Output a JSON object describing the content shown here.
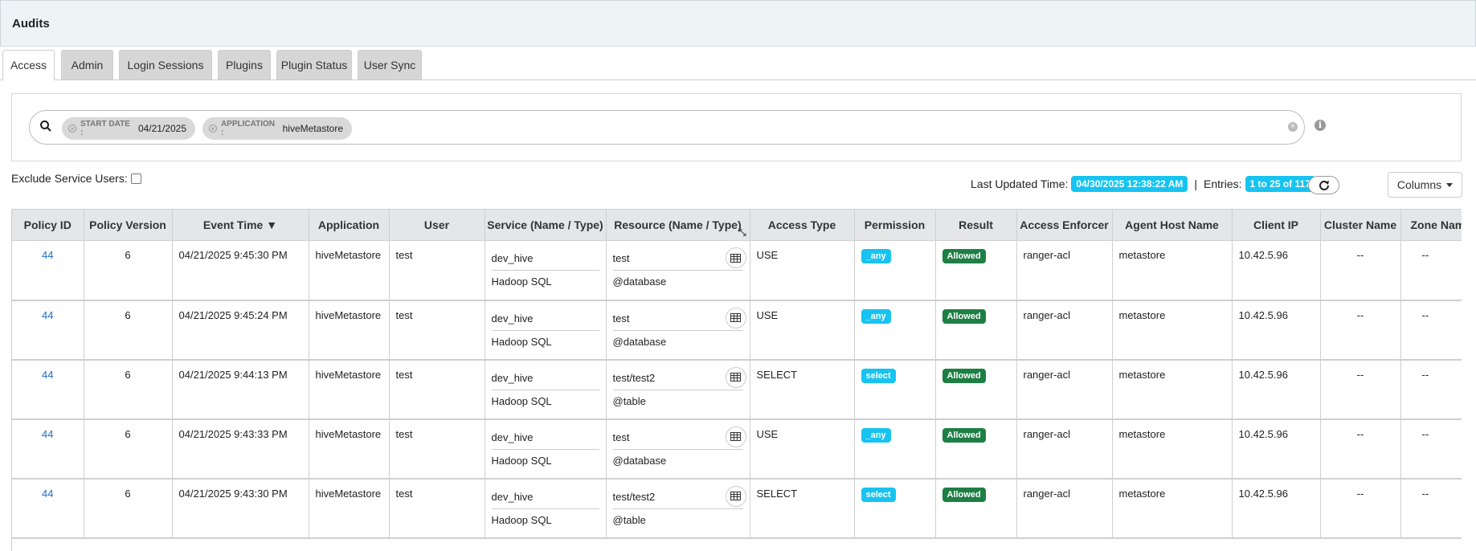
{
  "header": {
    "title": "Audits"
  },
  "tabs": [
    {
      "label": "Access",
      "active": true
    },
    {
      "label": "Admin"
    },
    {
      "label": "Login Sessions"
    },
    {
      "label": "Plugins"
    },
    {
      "label": "Plugin Status"
    },
    {
      "label": "User Sync"
    }
  ],
  "search": {
    "chips": [
      {
        "key": "START DATE :",
        "value": "04/21/2025"
      },
      {
        "key": "APPLICATION :",
        "value": "hiveMetastore"
      }
    ]
  },
  "filters": {
    "exclude_service_users": "Exclude Service Users:",
    "exclude_checked": false
  },
  "meta": {
    "last_updated_label": "Last Updated Time:",
    "last_updated_value": "04/30/2025 12:38:22 AM",
    "separator": "|",
    "entries_label": "Entries:",
    "entries_value": "1 to 25 of 117"
  },
  "columns_button": "Columns",
  "table": {
    "headers": [
      "Policy ID",
      "Policy Version",
      "Event Time ▼",
      "Application",
      "User",
      "Service (Name / Type)",
      "Resource (Name / Type)",
      "Access Type",
      "Permission",
      "Result",
      "Access Enforcer",
      "Agent Host Name",
      "Client IP",
      "Cluster Name",
      "Zone Nam"
    ],
    "rows": [
      {
        "policy_id": "44",
        "version": "6",
        "time": "04/21/2025 9:45:30 PM",
        "app": "hiveMetastore",
        "user": "test",
        "service_name": "dev_hive",
        "service_type": "Hadoop SQL",
        "resource_name": "test",
        "resource_type": "@database",
        "access_type": "USE",
        "permission": "_any",
        "result": "Allowed",
        "enforcer": "ranger-acl",
        "agent_host": "metastore",
        "client_ip": "10.42.5.96",
        "cluster": "--",
        "zone": "--"
      },
      {
        "policy_id": "44",
        "version": "6",
        "time": "04/21/2025 9:45:24 PM",
        "app": "hiveMetastore",
        "user": "test",
        "service_name": "dev_hive",
        "service_type": "Hadoop SQL",
        "resource_name": "test",
        "resource_type": "@database",
        "access_type": "USE",
        "permission": "_any",
        "result": "Allowed",
        "enforcer": "ranger-acl",
        "agent_host": "metastore",
        "client_ip": "10.42.5.96",
        "cluster": "--",
        "zone": "--"
      },
      {
        "policy_id": "44",
        "version": "6",
        "time": "04/21/2025 9:44:13 PM",
        "app": "hiveMetastore",
        "user": "test",
        "service_name": "dev_hive",
        "service_type": "Hadoop SQL",
        "resource_name": "test/test2",
        "resource_type": "@table",
        "access_type": "SELECT",
        "permission": "select",
        "result": "Allowed",
        "enforcer": "ranger-acl",
        "agent_host": "metastore",
        "client_ip": "10.42.5.96",
        "cluster": "--",
        "zone": "--"
      },
      {
        "policy_id": "44",
        "version": "6",
        "time": "04/21/2025 9:43:33 PM",
        "app": "hiveMetastore",
        "user": "test",
        "service_name": "dev_hive",
        "service_type": "Hadoop SQL",
        "resource_name": "test",
        "resource_type": "@database",
        "access_type": "USE",
        "permission": "_any",
        "result": "Allowed",
        "enforcer": "ranger-acl",
        "agent_host": "metastore",
        "client_ip": "10.42.5.96",
        "cluster": "--",
        "zone": "--"
      },
      {
        "policy_id": "44",
        "version": "6",
        "time": "04/21/2025 9:43:30 PM",
        "app": "hiveMetastore",
        "user": "test",
        "service_name": "dev_hive",
        "service_type": "Hadoop SQL",
        "resource_name": "test/test2",
        "resource_type": "@table",
        "access_type": "SELECT",
        "permission": "select",
        "result": "Allowed",
        "enforcer": "ranger-acl",
        "agent_host": "metastore",
        "client_ip": "10.42.5.96",
        "cluster": "--",
        "zone": "--"
      }
    ]
  },
  "colors": {
    "permission_badge": "#17c3f0",
    "allowed_badge": "#1e7f45",
    "link": "#1a6ec8",
    "header_bg": "#edf4f6"
  },
  "icons": {
    "search": "search-icon",
    "info": "info-icon",
    "refresh": "refresh-icon",
    "table": "table-icon",
    "clear": "clear-icon",
    "expand": "expand-icon"
  }
}
